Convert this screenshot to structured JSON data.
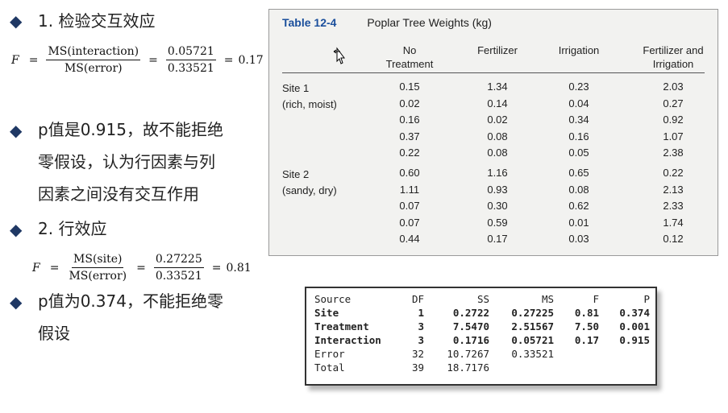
{
  "left": {
    "b1": "1. 检验交互效应",
    "f1": {
      "lhs": "F",
      "num1": "MS(interaction)",
      "den1": "MS(error)",
      "num2": "0.05721",
      "den2": "0.33521",
      "result": "0.17"
    },
    "b2_line1": "p值是0.915，故不能拒绝",
    "b2_line2": "零假设，认为行因素与列",
    "b2_line3": "因素之间没有交互作用",
    "b3": "2. 行效应",
    "f2": {
      "lhs": "F",
      "num1": "MS(site)",
      "den1": "MS(error)",
      "num2": "0.27225",
      "den2": "0.33521",
      "result": "0.81"
    },
    "b4_line1": "p值为0.374，不能拒绝零",
    "b4_line2": "假设"
  },
  "table": {
    "number": "Table 12-4",
    "title": "Poplar Tree Weights (kg)",
    "columns": [
      "No Treatment",
      "Fertilizer",
      "Irrigation",
      "Fertilizer and Irrigation"
    ],
    "col_lines": [
      [
        "No",
        "Treatment"
      ],
      [
        "",
        "Fertilizer"
      ],
      [
        "",
        "Irrigation"
      ],
      [
        "Fertilizer and",
        "Irrigation"
      ]
    ],
    "site1_label": [
      "Site 1",
      "(rich, moist)"
    ],
    "site2_label": [
      "Site 2",
      "(sandy, dry)"
    ],
    "site1": [
      [
        "0.15",
        "1.34",
        "0.23",
        "2.03"
      ],
      [
        "0.02",
        "0.14",
        "0.04",
        "0.27"
      ],
      [
        "0.16",
        "0.02",
        "0.34",
        "0.92"
      ],
      [
        "0.37",
        "0.08",
        "0.16",
        "1.07"
      ],
      [
        "0.22",
        "0.08",
        "0.05",
        "2.38"
      ]
    ],
    "site2": [
      [
        "0.60",
        "1.16",
        "0.65",
        "0.22"
      ],
      [
        "1.11",
        "0.93",
        "0.08",
        "2.13"
      ],
      [
        "0.07",
        "0.30",
        "0.62",
        "2.33"
      ],
      [
        "0.07",
        "0.59",
        "0.01",
        "1.74"
      ],
      [
        "0.44",
        "0.17",
        "0.03",
        "0.12"
      ]
    ]
  },
  "anova": {
    "header": [
      "Source",
      "DF",
      "SS",
      "MS",
      "F",
      "P"
    ],
    "rows": [
      {
        "source": "Site",
        "df": "1",
        "ss": "0.2722",
        "ms": "0.27225",
        "f": "0.81",
        "p": "0.374",
        "bold": true
      },
      {
        "source": "Treatment",
        "df": "3",
        "ss": "7.5470",
        "ms": "2.51567",
        "f": "7.50",
        "p": "0.001",
        "bold": true
      },
      {
        "source": "Interaction",
        "df": "3",
        "ss": "0.1716",
        "ms": "0.05721",
        "f": "0.17",
        "p": "0.915",
        "bold": true
      },
      {
        "source": "Error",
        "df": "32",
        "ss": "10.7267",
        "ms": "0.33521",
        "f": "",
        "p": "",
        "bold": false
      },
      {
        "source": "Total",
        "df": "39",
        "ss": "18.7176",
        "ms": "",
        "f": "",
        "p": "",
        "bold": false
      }
    ]
  }
}
